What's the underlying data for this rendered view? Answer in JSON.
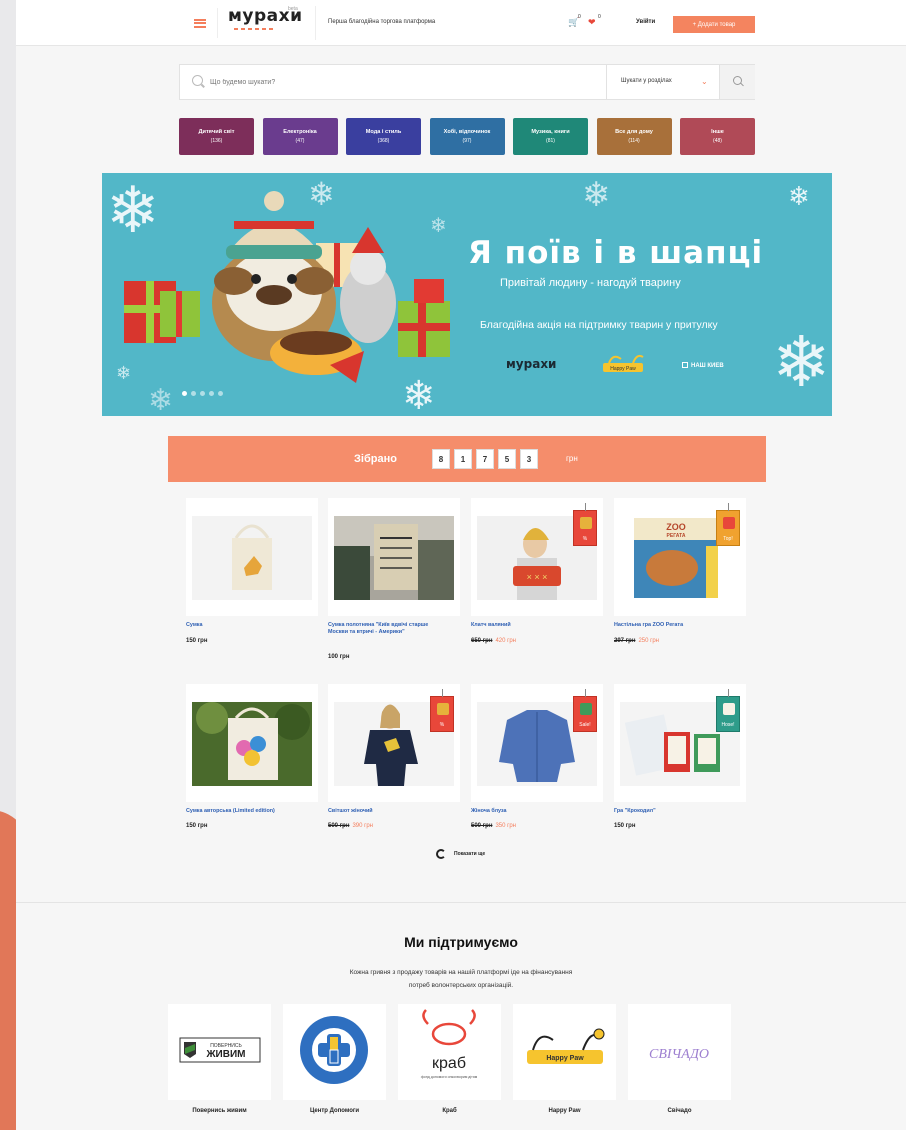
{
  "header": {
    "logo_text": "мурахи",
    "logo_sup": "beta",
    "tagline": "Перша благодійна торгова платформа",
    "cart_count": "0",
    "wishlist_count": "0",
    "login_label": "Увійти",
    "add_product_label": "+ Додати товар"
  },
  "search": {
    "placeholder": "Що будемо шукати?",
    "scope_label": "Шукати у розділах"
  },
  "categories": [
    {
      "name": "Дитячий світ",
      "count": "(136)",
      "color": "#7d2e5a"
    },
    {
      "name": "Електроніка",
      "count": "(47)",
      "color": "#6a3c8e"
    },
    {
      "name": "Мода і стиль",
      "count": "(368)",
      "color": "#3a3f9f"
    },
    {
      "name": "Хобі, відпочинок",
      "count": "(97)",
      "color": "#2f6fa3"
    },
    {
      "name": "Музика, книги",
      "count": "(81)",
      "color": "#1f8878"
    },
    {
      "name": "Все для дому",
      "count": "(114)",
      "color": "#a8703a"
    },
    {
      "name": "Інше",
      "count": "(48)",
      "color": "#b04a57"
    }
  ],
  "banner": {
    "title": "Я поїв і в шапці",
    "subtitle": "Привітай людину - нагодуй тварину",
    "description": "Благодійна акція на підтримку тварин у притулку",
    "partner1": "мурахи",
    "partner2": "Happy Paw",
    "partner3": "НАШ КИЕВ"
  },
  "collected": {
    "label": "Зібрано",
    "digits": [
      "8",
      "1",
      "7",
      "5",
      "3"
    ],
    "currency": "грн"
  },
  "products": [
    {
      "name": "Сумка",
      "price": "150 грн",
      "old_price": "",
      "new_price": ""
    },
    {
      "name": "Сумка полотняна \"Київ вдвічі старше Москви та втричі - Америки\"",
      "price": "100 грн",
      "old_price": "",
      "new_price": ""
    },
    {
      "name": "Клатч валяний",
      "price": "",
      "old_price": "650 грн",
      "new_price": "420 грн",
      "tag": "%"
    },
    {
      "name": "Настільна гра ZOO Регата",
      "price": "",
      "old_price": "297 грн",
      "new_price": "250 грн",
      "tag": "Top!"
    },
    {
      "name": "Сумка авторська (Limited edition)",
      "price": "150 грн",
      "old_price": "",
      "new_price": ""
    },
    {
      "name": "Світшот жіночий",
      "price": "",
      "old_price": "500 грн",
      "new_price": "390 грн",
      "tag": "%"
    },
    {
      "name": "Жіноча блуза",
      "price": "",
      "old_price": "500 грн",
      "new_price": "350 грн",
      "tag": "Sale!"
    },
    {
      "name": "Гра \"Крокодил\"",
      "price": "150 грн",
      "old_price": "",
      "new_price": "",
      "tag": "Hose!"
    }
  ],
  "zoo_cover": {
    "title": "ZOO",
    "subtitle": "РЕГАТА"
  },
  "show_more_label": "Показати ще",
  "support": {
    "title": "Ми підтримуємо",
    "text_line1": "Кожна гривня з продажу товарів на нашій платформі іде на фінансування",
    "text_line2": "потреб волонтерських організацій.",
    "orgs": [
      {
        "name": "Повернись живим",
        "logo_line1": "ПОВЕРНИСЬ",
        "logo_line2": "ЖИВИМ"
      },
      {
        "name": "Центр Допомоги"
      },
      {
        "name": "Краб",
        "logo_text": "краб",
        "logo_caption": "фонд допомоги онкохворим дітям"
      },
      {
        "name": "Happy Paw",
        "logo_text": "Happy Paw"
      },
      {
        "name": "Свічадо",
        "logo_text": "СВІЧАДО"
      }
    ]
  }
}
